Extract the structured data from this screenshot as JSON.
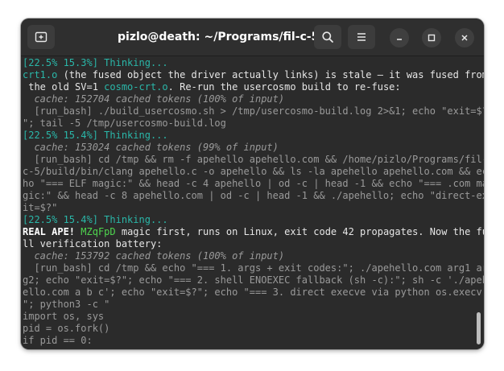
{
  "window": {
    "title": "pizlo@death: ~/Programs/fil-c-5"
  },
  "icons": {
    "new_tab": "new-tab-icon",
    "search": "search-icon",
    "menu": "hamburger-menu-icon",
    "minimize": "minimize-icon",
    "maximize": "maximize-icon",
    "close": "close-icon"
  },
  "terminal": {
    "l1": "[22.5% 15.3%] Thinking...",
    "l2_a": "crt1.o",
    "l2_b": " (the fused object the driver actually links) is stale — it was fused from",
    "l3_a": " the old SV=1 ",
    "l3_b": "cosmo-crt.o",
    "l3_c": ". Re-run the usercosmo build to re-fuse:",
    "l4": "  cache: 152704 cached tokens (100% of input)",
    "l5": "  [run_bash] ./build_usercosmo.sh > /tmp/usercosmo-build.log 2>&1; echo \"exit=$?",
    "l6": "\"; tail -5 /tmp/usercosmo-build.log",
    "l7": "[22.5% 15.4%] Thinking...",
    "l8": "  cache: 153024 cached tokens (99% of input)",
    "l9": "  [run_bash] cd /tmp && rm -f apehello apehello.com && /home/pizlo/Programs/fil-",
    "l10": "c-5/build/bin/clang apehello.c -o apehello && ls -la apehello apehello.com && ec",
    "l11": "ho \"=== ELF magic:\" && head -c 4 apehello | od -c | head -1 && echo \"=== .com ma",
    "l12": "gic:\" && head -c 8 apehello.com | od -c | head -1 && ./apehello; echo \"direct-ex",
    "l13": "it=$?\"",
    "l14": "[22.5% 15.4%] Thinking...",
    "l15_a": "REAL APE!",
    "l15_b": " ",
    "l15_c": "MZqFpD",
    "l15_d": " magic first, runs on Linux, exit code 42 propagates. Now the fu",
    "l16": "ll verification battery:",
    "l17": "  cache: 153792 cached tokens (100% of input)",
    "l18": "  [run_bash] cd /tmp && echo \"=== 1. args + exit codes:\"; ./apehello.com arg1 ar",
    "l19": "g2; echo \"exit=$?\"; echo \"=== 2. shell ENOEXEC fallback (sh -c):\"; sh -c './apeh",
    "l20": "ello.com a b c'; echo \"exit=$?\"; echo \"=== 3. direct execve via python os.execv:",
    "l21": "\"; python3 -c \"",
    "l22": "import os, sys",
    "l23": "pid = os.fork()",
    "l24": "if pid == 0:"
  },
  "colors": {
    "background": "#2b2b2b",
    "titlebar": "#2f2f2f",
    "teal": "#2ab7a9",
    "green": "#4fd64f",
    "dim": "#9a9a9a"
  }
}
